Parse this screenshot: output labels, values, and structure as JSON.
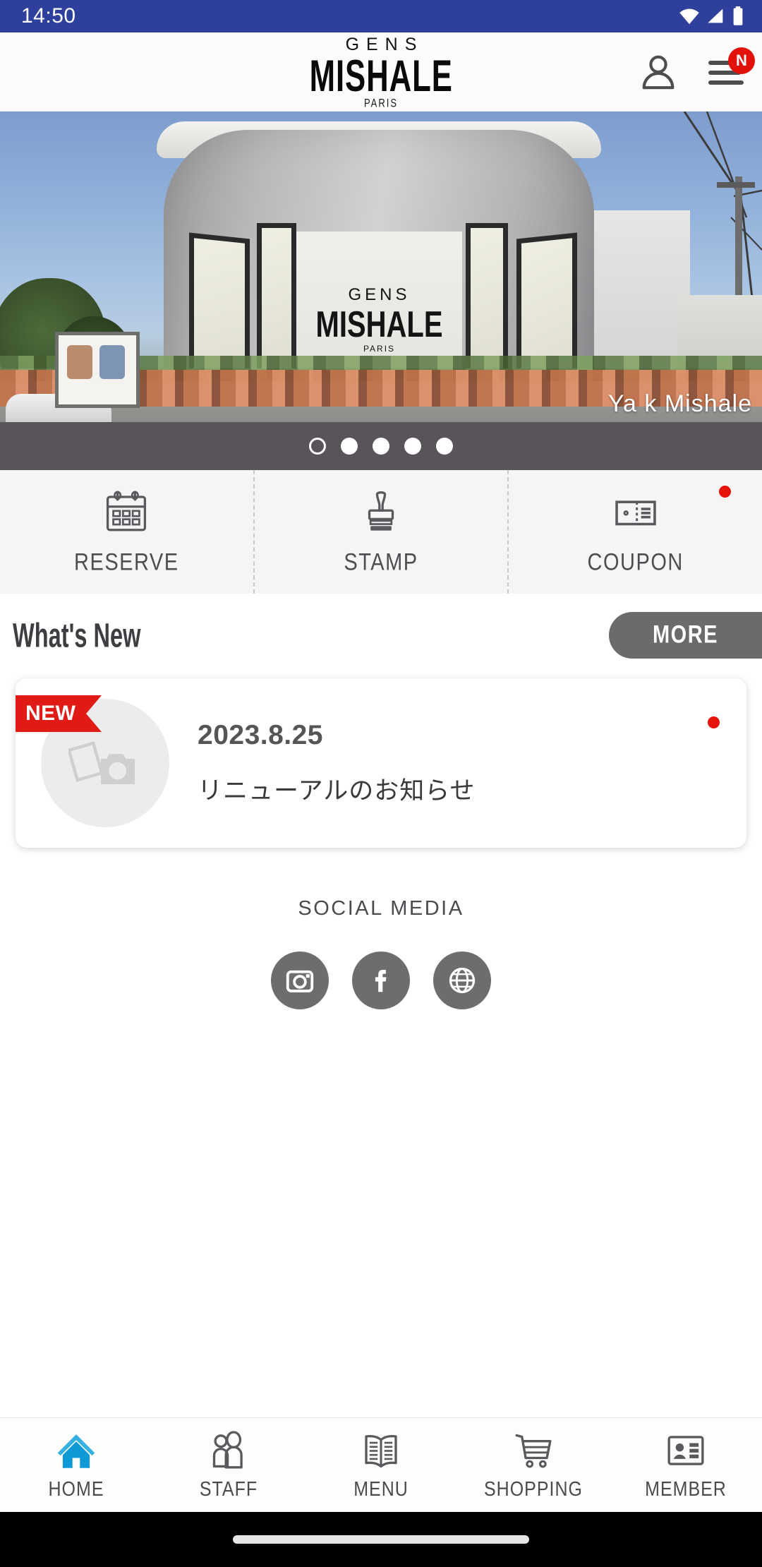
{
  "status_bar": {
    "time": "14:50",
    "icons": [
      "wifi-icon",
      "cellular-signal-icon",
      "battery-icon"
    ]
  },
  "header": {
    "logo_top": "GENS",
    "logo_middle": "MISHALE",
    "logo_bottom": "PARIS",
    "account_icon": "person-icon",
    "menu_icon": "hamburger-menu-icon",
    "menu_badge": "N"
  },
  "hero": {
    "caption": "Ya k Mishale",
    "carousel": {
      "total": 5,
      "active_index": 0
    }
  },
  "quick_actions": [
    {
      "label": "RESERVE",
      "icon": "calendar-icon",
      "badge": false
    },
    {
      "label": "STAMP",
      "icon": "stamp-icon",
      "badge": false
    },
    {
      "label": "COUPON",
      "icon": "coupon-ticket-icon",
      "badge": true
    }
  ],
  "whats_new": {
    "title": "What's New",
    "more_label": "MORE",
    "items": [
      {
        "ribbon": "NEW",
        "date": "2023.8.25",
        "subject": "リニューアルのお知らせ",
        "thumbnail_icon": "image-placeholder-camera-icon",
        "unread": true
      }
    ]
  },
  "social_media": {
    "title": "SOCIAL MEDIA",
    "links": [
      {
        "name": "instagram-icon"
      },
      {
        "name": "facebook-icon"
      },
      {
        "name": "website-globe-icon"
      }
    ]
  },
  "bottom_nav": {
    "active": "HOME",
    "items": [
      {
        "label": "HOME",
        "icon": "home-icon"
      },
      {
        "label": "STAFF",
        "icon": "people-icon"
      },
      {
        "label": "MENU",
        "icon": "open-book-icon"
      },
      {
        "label": "SHOPPING",
        "icon": "shopping-cart-icon"
      },
      {
        "label": "MEMBER",
        "icon": "member-card-icon"
      }
    ]
  },
  "colors": {
    "status_bar": "#2f409c",
    "accent_red": "#e2120b",
    "ribbon_red": "#e01a15",
    "more_button_gray": "#6b6b6d",
    "dots_bar_gray": "#58545a",
    "active_nav_blue": "#1b9dd9",
    "quick_bg": "#f5f5f6"
  }
}
